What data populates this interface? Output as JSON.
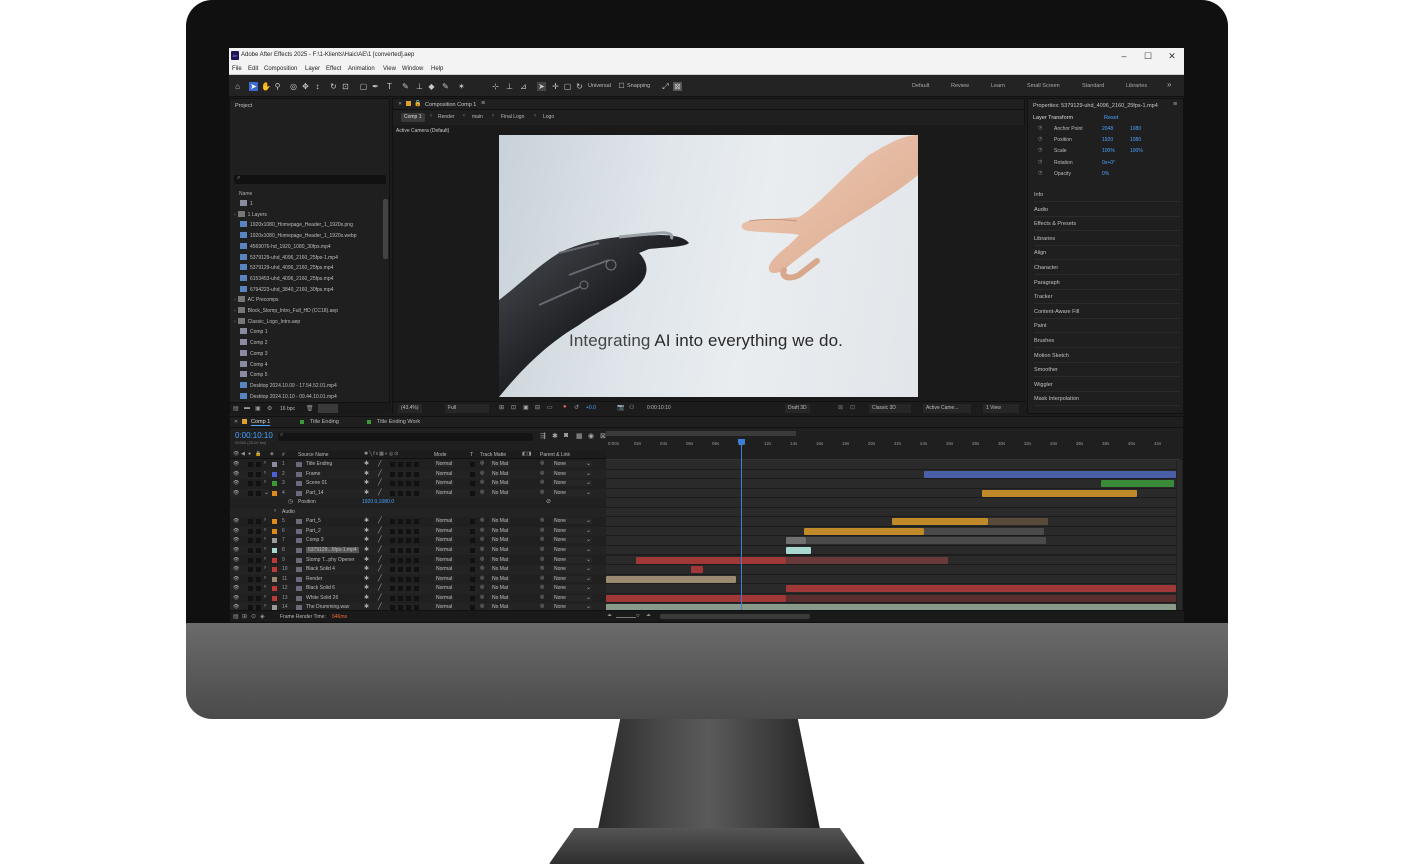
{
  "window": {
    "title": "Adobe After Effects 2025 - F:\\1-Klients\\Haic\\AE\\1 [converted].aep",
    "minimize": "–",
    "maximize": "☐",
    "close": "✕"
  },
  "menu": [
    "File",
    "Edit",
    "Composition",
    "Layer",
    "Effect",
    "Animation",
    "View",
    "Window",
    "Help"
  ],
  "toolbar": {
    "axis_mode": "Universal",
    "snapping": "Snapping",
    "workspaces": [
      "Default",
      "Review",
      "Learn",
      "Small Screen",
      "Standard",
      "Libraries"
    ],
    "more": "»"
  },
  "project": {
    "title": "Project",
    "search_placeholder": "⌕",
    "column_name": "Name",
    "items": [
      {
        "name": "1",
        "type": "comp"
      },
      {
        "name": "1 Layers",
        "type": "folder"
      },
      {
        "name": "1920x1080_Homepage_Header_1_1920x.png",
        "type": "file"
      },
      {
        "name": "1920x1080_Homepage_Header_1_1920x.webp",
        "type": "file"
      },
      {
        "name": "4569076-hd_1920_1080_30fps.mp4",
        "type": "file"
      },
      {
        "name": "5379129-uhd_4096_2160_25fps-1.mp4",
        "type": "file"
      },
      {
        "name": "5379129-uhd_4096_2160_25fps.mp4",
        "type": "file"
      },
      {
        "name": "6153453-uhd_4096_2160_25fps.mp4",
        "type": "file"
      },
      {
        "name": "6794223-uhd_3840_2160_30fps.mp4",
        "type": "file"
      },
      {
        "name": "AC Precomps",
        "type": "folder"
      },
      {
        "name": "Block_Stomp_Intro_Full_HD (CC18).aep",
        "type": "folder"
      },
      {
        "name": "Classic_Logo_Intro.aep",
        "type": "folder"
      },
      {
        "name": "Comp 1",
        "type": "comp"
      },
      {
        "name": "Comp 2",
        "type": "comp"
      },
      {
        "name": "Comp 3",
        "type": "comp"
      },
      {
        "name": "Comp 4",
        "type": "comp"
      },
      {
        "name": "Comp 5",
        "type": "comp"
      },
      {
        "name": "Desktop 2024.10.09 - 17.54.52.01.mp4",
        "type": "file"
      },
      {
        "name": "Desktop 2024.10.10 - 09.44.10.01.mp4",
        "type": "file"
      }
    ],
    "bpc": "16 bpc"
  },
  "composition": {
    "panel_title": "Composition Comp 1",
    "breadcrumbs": [
      "Comp 1",
      "Render",
      "main",
      "Final Logo",
      "Logo"
    ],
    "camera_label": "Active Camera (Default)",
    "caption_light": "Integrating",
    "caption_bold": "AI into everything we do.",
    "zoom": "(43.4%)",
    "resolution": "Full",
    "exposure": "+0.0",
    "timecode": "0:00:10:10",
    "draft": "Draft 3D",
    "renderer": "Classic 3D",
    "camera": "Active Came...",
    "views": "1 View"
  },
  "properties": {
    "title": "Properties: 5379129-uhd_4096_2160_25fps-1.mp4",
    "section": "Layer Transform",
    "reset": "Reset",
    "rows": [
      {
        "label": "Anchor Point",
        "v1": "2048",
        "v2": "1080"
      },
      {
        "label": "Position",
        "v1": "1920",
        "v2": "1080"
      },
      {
        "label": "Scale",
        "v1": "100%",
        "v2": "100%"
      },
      {
        "label": "Rotation",
        "v1": "0x+0°",
        "v2": ""
      },
      {
        "label": "Opacity",
        "v1": "0%",
        "v2": ""
      }
    ],
    "panels": [
      "Info",
      "Audio",
      "Effects & Presets",
      "Libraries",
      "Align",
      "Character",
      "Paragraph",
      "Tracker",
      "Content-Aware Fill",
      "Paint",
      "Brushes",
      "Motion Sketch",
      "Smoother",
      "Wiggler",
      "Mask Interpolation"
    ]
  },
  "timeline": {
    "tabs": [
      "Comp 1",
      "Title Ending",
      "Title Ending Work"
    ],
    "timecode": "0:00:10:10",
    "frames": "00260 (25.00 fps)",
    "columns": {
      "source": "Source Name",
      "mode": "Mode",
      "t": "T",
      "track_matte": "Track Matte",
      "parent": "Parent & Link"
    },
    "ticks": [
      "0:00s",
      "02s",
      "04s",
      "06s",
      "08s",
      "10s",
      "12s",
      "14s",
      "16s",
      "18s",
      "20s",
      "22s",
      "24s",
      "26s",
      "28s",
      "30s",
      "32s",
      "34s",
      "36s",
      "38s",
      "40s",
      "42s"
    ],
    "position_row": {
      "label": "Position",
      "value": "1920.0,1080.0"
    },
    "audio_label": "Audio",
    "layers": [
      {
        "num": "1",
        "name": "Title Ending",
        "label": "#8a8aa0",
        "mode": "Normal",
        "matte": "No Mat",
        "parent": "None"
      },
      {
        "num": "2",
        "name": "Frame",
        "label": "#4b5fd6",
        "mode": "Normal",
        "matte": "No Mat",
        "parent": "None"
      },
      {
        "num": "3",
        "name": "Scene 01",
        "label": "#3a9a3a",
        "mode": "Normal",
        "matte": "No Mat",
        "parent": "None"
      },
      {
        "num": "4",
        "name": "Part_14",
        "label": "#e08a1a",
        "mode": "Normal",
        "matte": "No Mat",
        "parent": "None"
      },
      {
        "num": "5",
        "name": "Part_5",
        "label": "#e08a1a",
        "mode": "Normal",
        "matte": "No Mat",
        "parent": "None"
      },
      {
        "num": "6",
        "name": "Part_2",
        "label": "#e08a1a",
        "mode": "Normal",
        "matte": "No Mat",
        "parent": "None"
      },
      {
        "num": "7",
        "name": "Comp 3",
        "label": "#9a9a9a",
        "mode": "Normal",
        "matte": "No Mat",
        "parent": "None"
      },
      {
        "num": "8",
        "name": "5379129...5fps-1.mp4",
        "label": "#a8d8d0",
        "mode": "Normal",
        "matte": "No Mat",
        "parent": "None"
      },
      {
        "num": "9",
        "name": "Stomp T...phy Opener",
        "label": "#c0393a",
        "mode": "Normal",
        "matte": "No Mat",
        "parent": "None"
      },
      {
        "num": "10",
        "name": "Black Solid 4",
        "label": "#c0393a",
        "mode": "Normal",
        "matte": "No Mat",
        "parent": "None"
      },
      {
        "num": "11",
        "name": "Render",
        "label": "#9a8a70",
        "mode": "Normal",
        "matte": "No Mat",
        "parent": "None"
      },
      {
        "num": "12",
        "name": "Black Solid 6",
        "label": "#c0393a",
        "mode": "Normal",
        "matte": "No Mat",
        "parent": "None"
      },
      {
        "num": "13",
        "name": "White Solid 26",
        "label": "#c0393a",
        "mode": "Normal",
        "matte": "No Mat",
        "parent": "None"
      },
      {
        "num": "14",
        "name": "The Drumming.wav",
        "label": "#9a9a9a",
        "mode": "Normal",
        "matte": "No Mat",
        "parent": "None"
      }
    ],
    "footer_label": "Frame Render Time:",
    "footer_value": "646ms"
  },
  "colors": {
    "accent": "#4aa3ff",
    "render_time": "#ff6a3a",
    "playhead": "#3b7fd8"
  }
}
